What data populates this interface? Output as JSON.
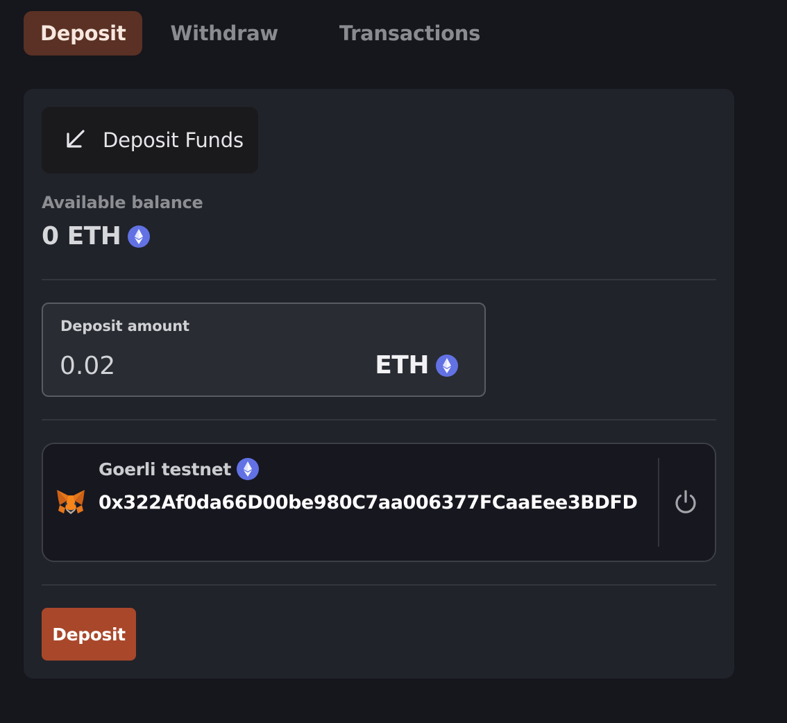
{
  "tabs": [
    {
      "label": "Deposit",
      "active": true
    },
    {
      "label": "Withdraw",
      "active": false
    },
    {
      "label": "Transactions",
      "active": false
    }
  ],
  "header": {
    "icon": "arrow-down-left-icon",
    "title": "Deposit Funds"
  },
  "balance": {
    "label": "Available balance",
    "value": "0 ETH",
    "icon": "ethereum-icon"
  },
  "amount": {
    "label": "Deposit amount",
    "value": "0.02",
    "unit": "ETH",
    "icon": "ethereum-icon"
  },
  "wallet": {
    "icon": "metamask-fox-icon",
    "network": "Goerli testnet",
    "address": "0x322Af0da66D00be980C7aa006377FCaaEee3BDFD",
    "disconnect_icon": "power-icon"
  },
  "action": {
    "submit_label": "Deposit"
  },
  "colors": {
    "background": "#16161d",
    "card": "#20232a",
    "active_tab": "#5a3124",
    "accent": "#a9472a",
    "eth_badge": "#6272e4"
  }
}
